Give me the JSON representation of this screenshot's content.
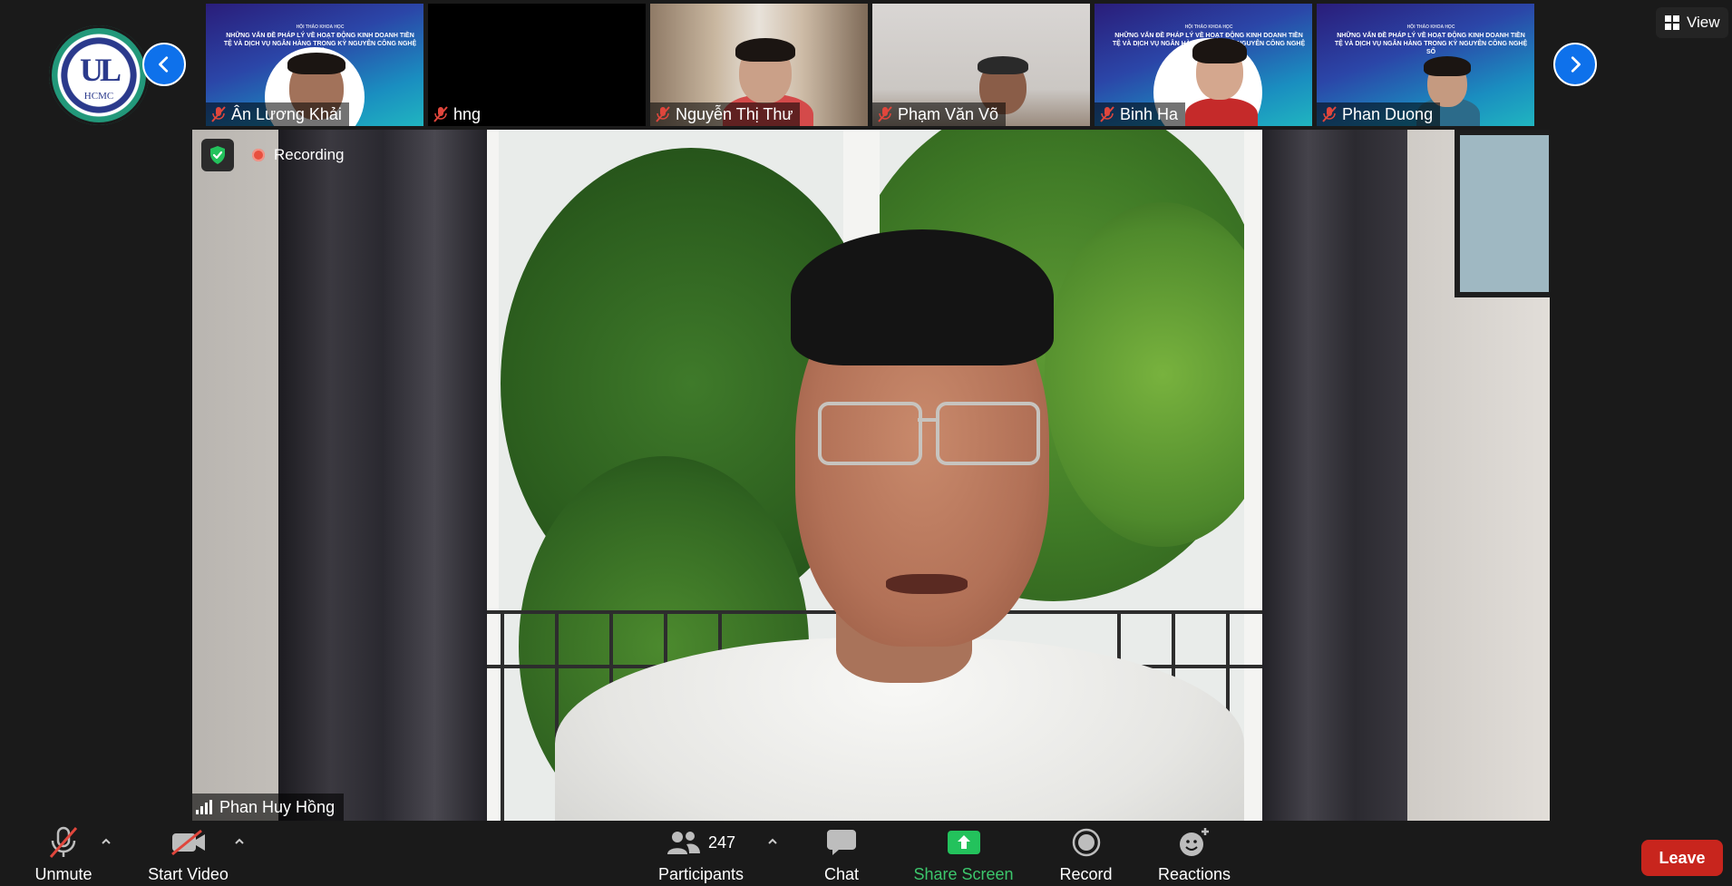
{
  "app": {
    "logo": {
      "monogram": "UL",
      "subtitle": "HCMC"
    }
  },
  "gallery": {
    "slide_title_pre": "HỘI THẢO KHOA HỌC",
    "slide_title": "NHỮNG VẤN ĐỀ PHÁP LÝ VỀ HOẠT ĐỘNG KINH DOANH TIỀN TỆ VÀ DỊCH VỤ NGÂN HÀNG TRONG KỶ NGUYÊN CÔNG NGHỆ SỐ",
    "participants": [
      {
        "name": "Ân Lương Khải",
        "muted": true
      },
      {
        "name": "hng",
        "muted": true
      },
      {
        "name": "Nguyễn Thị Thư",
        "muted": true
      },
      {
        "name": "Phạm Văn Võ",
        "muted": true
      },
      {
        "name": "Binh Ha",
        "muted": true
      },
      {
        "name": "Phan Duong",
        "muted": true
      }
    ]
  },
  "header": {
    "view_label": "View"
  },
  "main": {
    "recording_label": "Recording",
    "active_speaker": "Phan Huy Hồng"
  },
  "toolbar": {
    "unmute_label": "Unmute",
    "start_video_label": "Start Video",
    "participants_label": "Participants",
    "participants_count": "247",
    "chat_label": "Chat",
    "share_screen_label": "Share Screen",
    "record_label": "Record",
    "reactions_label": "Reactions",
    "leave_label": "Leave"
  },
  "colors": {
    "accent_blue": "#0e71eb",
    "share_green": "#3cc66c",
    "leave_red": "#c8251d",
    "recording_red": "#e8503f",
    "muted_red": "#e0463c"
  },
  "icons": [
    "chevron-left-icon",
    "chevron-right-icon",
    "mic-off-icon",
    "grid-icon",
    "shield-icon",
    "signal-icon",
    "video-off-icon",
    "participants-icon",
    "chat-icon",
    "share-arrow-icon",
    "record-icon",
    "reactions-icon",
    "caret-up-icon"
  ]
}
